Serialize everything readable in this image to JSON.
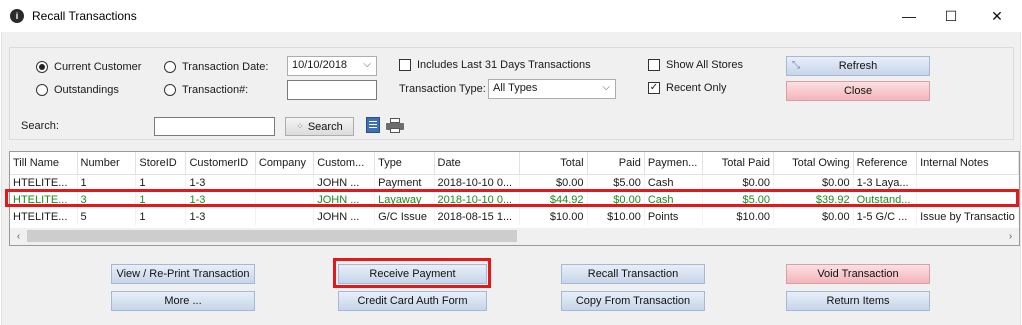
{
  "window": {
    "title": "Recall Transactions",
    "minimize": "—",
    "maximize": "☐",
    "close": "✕"
  },
  "filters": {
    "current_customer": "Current Customer",
    "outstandings": "Outstandings",
    "transaction_date_label": "Transaction Date:",
    "transaction_number_label": "Transaction#:",
    "transaction_date_value": "10/10/2018",
    "transaction_number_value": "",
    "includes_last_31": "Includes Last 31 Days Transactions",
    "transaction_type_label": "Transaction Type:",
    "transaction_type_value": "All Types",
    "show_all_stores": "Show All Stores",
    "recent_only": "Recent Only"
  },
  "buttons": {
    "refresh": "Refresh",
    "close": "Close",
    "search": "Search",
    "view_reprint": "View / Re-Print Transaction",
    "receive_payment": "Receive Payment",
    "recall_transaction": "Recall Transaction",
    "void_transaction": "Void Transaction",
    "more": "More ...",
    "credit_card_auth": "Credit Card Auth Form",
    "copy_from_transaction": "Copy From Transaction",
    "return_items": "Return Items"
  },
  "search": {
    "label": "Search:",
    "value": ""
  },
  "table": {
    "columns": [
      "Till Name",
      "Number",
      "StoreID",
      "CustomerID",
      "Company",
      "Custom...",
      "Type",
      "Date",
      "Total",
      "Paid",
      "Paymen...",
      "Total Paid",
      "Total Owing",
      "Reference",
      "Internal Notes"
    ],
    "rows": [
      [
        "HTELITE...",
        "1",
        "1",
        "1-3",
        "",
        "JOHN ...",
        "Payment",
        "2018-10-10 0...",
        "$0.00",
        "$5.00",
        "Cash",
        "$0.00",
        "$0.00",
        "1-3 Laya...",
        ""
      ],
      [
        "HTELITE...",
        "3",
        "1",
        "1-3",
        "",
        "JOHN ...",
        "Layaway",
        "2018-10-10 0...",
        "$44.92",
        "$0.00",
        "Cash",
        "$5.00",
        "$39.92",
        "Outstand...",
        ""
      ],
      [
        "HTELITE...",
        "5",
        "1",
        "1-3",
        "",
        "JOHN ...",
        "G/C Issue",
        "2018-08-15 1...",
        "$10.00",
        "$10.00",
        "Points",
        "$10.00",
        "$0.00",
        "1-5 G/C ...",
        "Issue by Transactio"
      ]
    ]
  },
  "colors": {
    "highlight": "#e31818",
    "outstanding_text": "#1d8a1d"
  }
}
